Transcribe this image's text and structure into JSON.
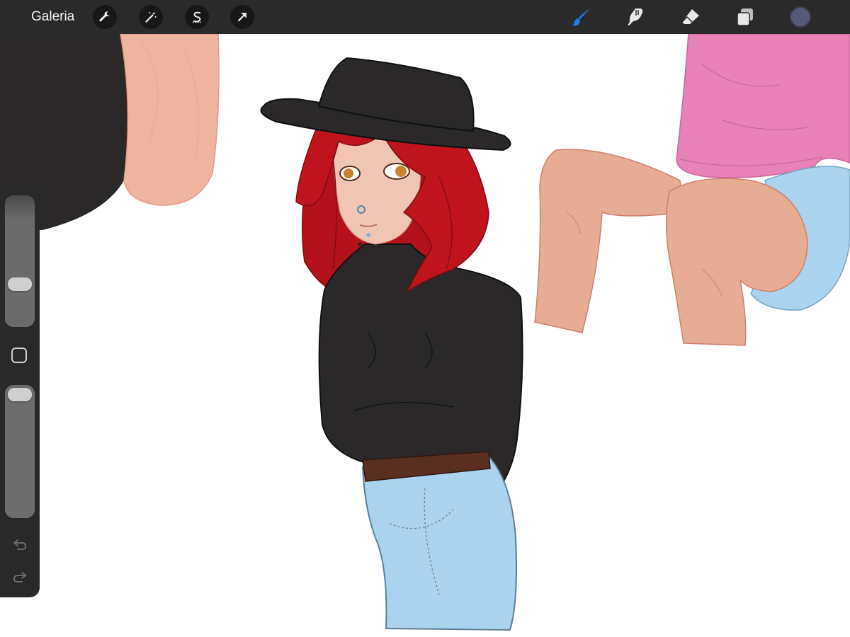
{
  "toolbar": {
    "gallery_label": "Galeria",
    "left_tools": [
      {
        "name": "actions-wrench-icon"
      },
      {
        "name": "adjustments-magic-wand-icon"
      },
      {
        "name": "selection-s-icon"
      },
      {
        "name": "transform-arrow-icon"
      }
    ],
    "right_tools": [
      {
        "name": "brush-icon",
        "active": true,
        "color": "#1f7bf2"
      },
      {
        "name": "smudge-icon",
        "active": false,
        "color": "#e8e8e8"
      },
      {
        "name": "eraser-icon",
        "active": false,
        "color": "#e8e8e8"
      },
      {
        "name": "layers-icon",
        "active": false,
        "color": "#e8e8e8"
      }
    ],
    "current_color": "#555a78"
  },
  "sidebar": {
    "brush_size_level": 0.62,
    "opacity_level": 0.95,
    "icons": [
      "modify-square-icon",
      "undo-icon",
      "redo-icon"
    ]
  },
  "colors": {
    "toolbar_bg": "#2b2a2b",
    "canvas_bg": "#ffffff",
    "hair": "#b3121a",
    "skin": "#e9b4a0",
    "sweater": "#2a2828",
    "jeans": "#a9d3ef",
    "belt": "#5b2e22",
    "hoodie": "#e781b6"
  }
}
